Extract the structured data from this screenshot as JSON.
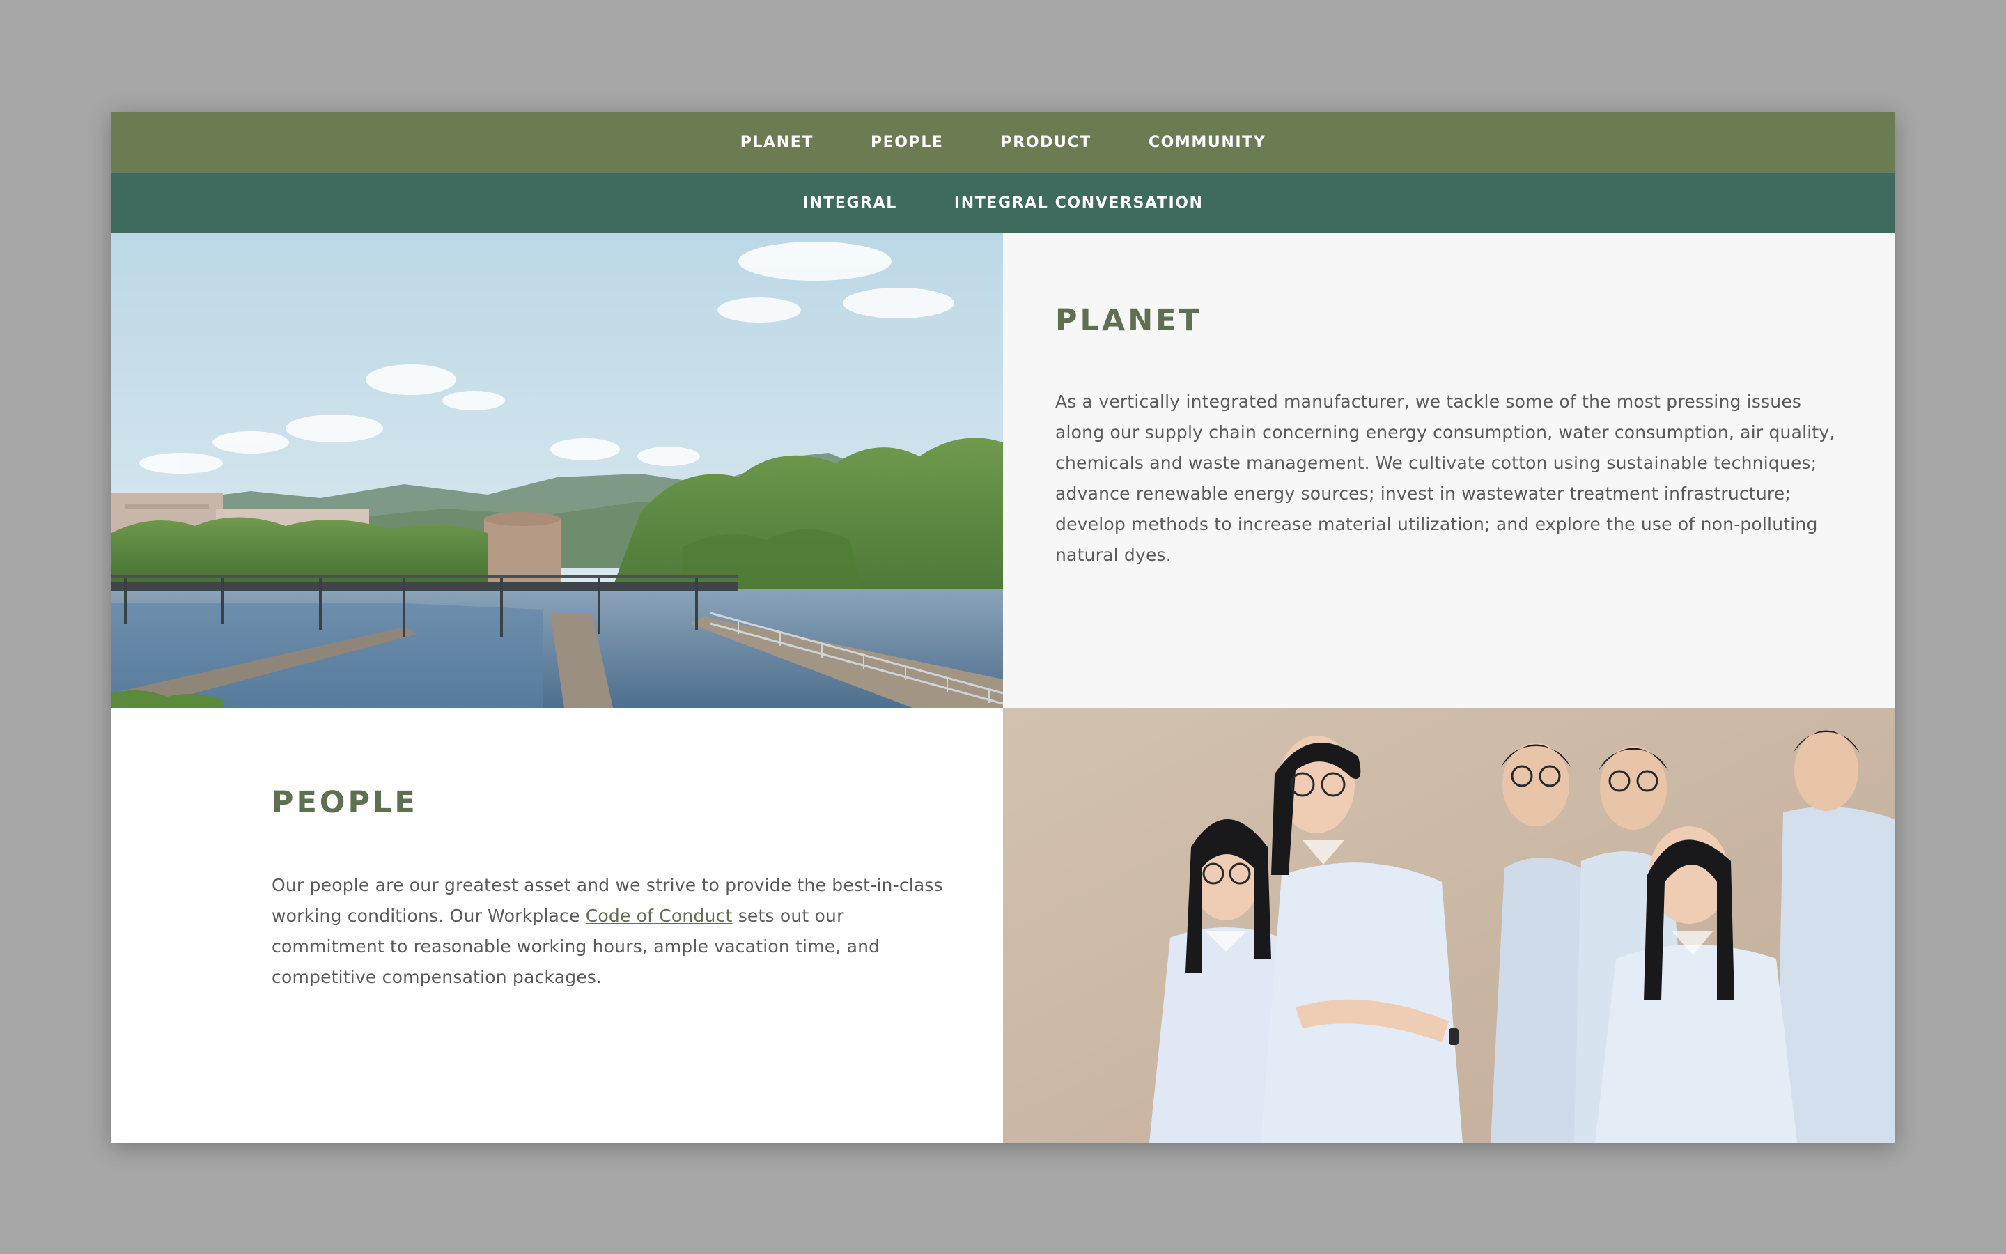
{
  "nav": {
    "primary": [
      {
        "label": "PLANET"
      },
      {
        "label": "PEOPLE"
      },
      {
        "label": "PRODUCT"
      },
      {
        "label": "COMMUNITY"
      }
    ],
    "secondary": [
      {
        "label": "INTEGRAL"
      },
      {
        "label": "INTEGRAL CONVERSATION"
      }
    ]
  },
  "planet": {
    "heading": "PLANET",
    "body": "As a vertically integrated manufacturer, we tackle some of the most pressing issues along our supply chain concerning energy consumption, water consumption, air quality, chemicals and waste management. We cultivate cotton using sustainable techniques; advance renewable energy sources; invest in wastewater treatment infrastructure; develop methods to increase material utilization; and explore the use of non-polluting natural dyes.",
    "expand_icon": "plus-icon"
  },
  "people": {
    "heading": "PEOPLE",
    "body_before_link": "Our people are our greatest asset and we strive to provide the best-in-class working conditions. Our Workplace ",
    "link_text": "Code of Conduct",
    "body_after_link": " sets out our commitment to reasonable working hours, ample vacation time, and competitive compensation packages.",
    "expand_icon": "plus-icon"
  },
  "colors": {
    "nav_primary_bg": "#6b7c53",
    "nav_secondary_bg": "#3e6b5e",
    "heading": "#5d7150",
    "panel_gray": "#f7f7f7",
    "button_gray": "#9d9d9d"
  }
}
